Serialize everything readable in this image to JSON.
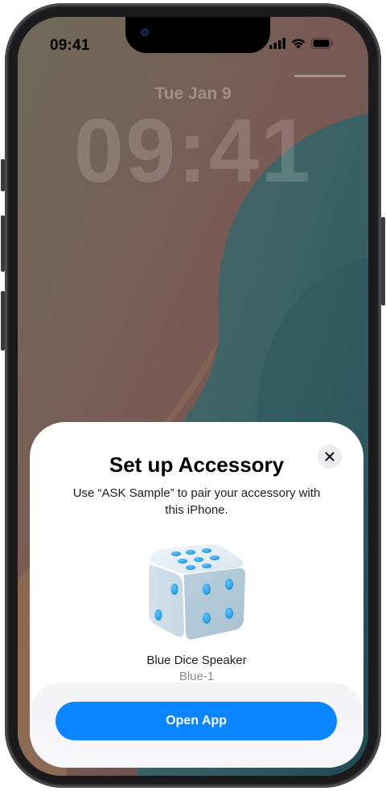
{
  "status_bar": {
    "time": "09:41",
    "icons": [
      "cellular-signal-icon",
      "wifi-icon",
      "battery-icon"
    ]
  },
  "lock_screen": {
    "date": "Tue Jan 9",
    "time": "09:41"
  },
  "setup_sheet": {
    "title": "Set up Accessory",
    "subtitle": "Use “ASK Sample” to pair your accessory with this iPhone.",
    "close_icon": "close-icon",
    "device": {
      "name": "Blue Dice Speaker",
      "variant": "Blue-1",
      "image_icon": "dice-icon"
    },
    "primary_button_label": "Open App"
  },
  "colors": {
    "accent": "#0a84ff",
    "sheet_background": "#ffffff",
    "dice_pip": "#2aa3e6"
  }
}
